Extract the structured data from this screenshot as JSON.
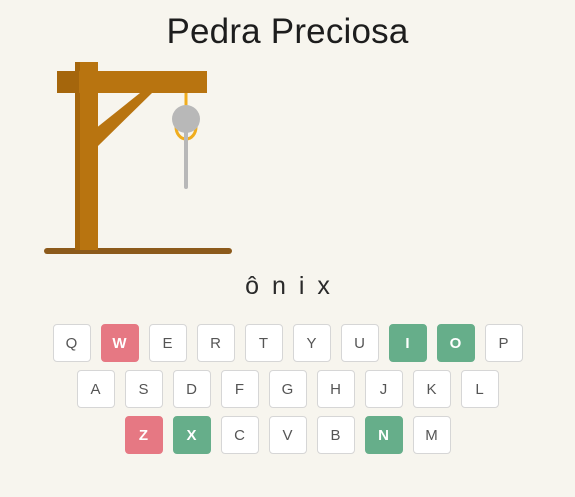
{
  "title": "Pedra Preciosa",
  "word": [
    "ô",
    "n",
    "i",
    "x"
  ],
  "colors": {
    "background": "#f7f5ee",
    "wood": "#b87410",
    "base": "#8c5a1b",
    "rope": "#f0ad1e",
    "figure": "#b8b8b8",
    "wrong": "#e67883",
    "correct": "#66ae8a"
  },
  "keyboard": {
    "rows": [
      [
        {
          "label": "Q",
          "state": "unused"
        },
        {
          "label": "W",
          "state": "wrong"
        },
        {
          "label": "E",
          "state": "unused"
        },
        {
          "label": "R",
          "state": "unused"
        },
        {
          "label": "T",
          "state": "unused"
        },
        {
          "label": "Y",
          "state": "unused"
        },
        {
          "label": "U",
          "state": "unused"
        },
        {
          "label": "I",
          "state": "correct"
        },
        {
          "label": "O",
          "state": "correct"
        },
        {
          "label": "P",
          "state": "unused"
        }
      ],
      [
        {
          "label": "A",
          "state": "unused"
        },
        {
          "label": "S",
          "state": "unused"
        },
        {
          "label": "D",
          "state": "unused"
        },
        {
          "label": "F",
          "state": "unused"
        },
        {
          "label": "G",
          "state": "unused"
        },
        {
          "label": "H",
          "state": "unused"
        },
        {
          "label": "J",
          "state": "unused"
        },
        {
          "label": "K",
          "state": "unused"
        },
        {
          "label": "L",
          "state": "unused"
        }
      ],
      [
        {
          "label": "Z",
          "state": "wrong"
        },
        {
          "label": "X",
          "state": "correct"
        },
        {
          "label": "C",
          "state": "unused"
        },
        {
          "label": "V",
          "state": "unused"
        },
        {
          "label": "B",
          "state": "unused"
        },
        {
          "label": "N",
          "state": "correct"
        },
        {
          "label": "M",
          "state": "unused"
        }
      ]
    ]
  }
}
